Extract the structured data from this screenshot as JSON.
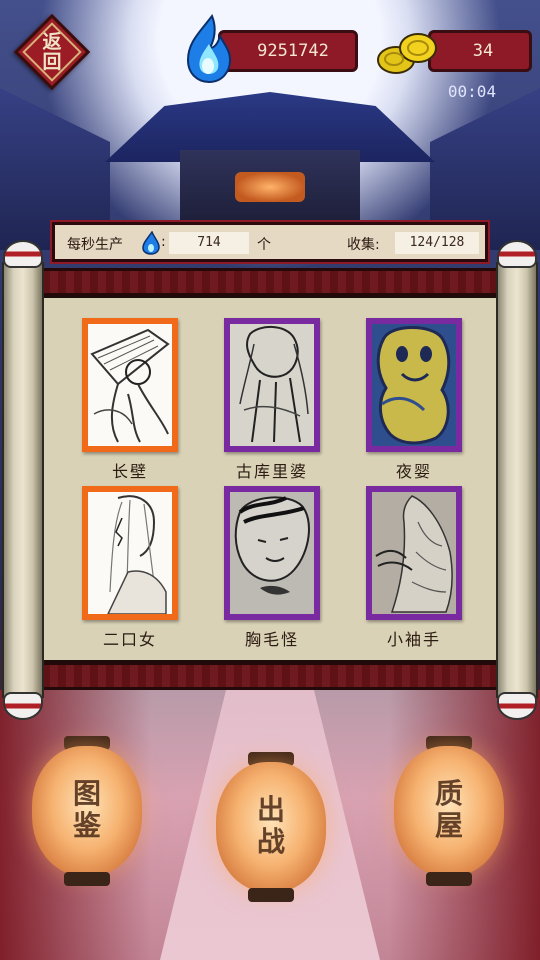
{
  "header": {
    "back_label_1": "返",
    "back_label_2": "回",
    "soul_fire": "9251742",
    "gold": "34",
    "timer": "00:04"
  },
  "info": {
    "production_label": "每秒生产",
    "production_value": "714",
    "production_unit": "个",
    "collect_label": "收集:",
    "collect_value": "124/128"
  },
  "monsters": [
    {
      "name": "长壁",
      "frame_color": "orange"
    },
    {
      "name": "古库里婆",
      "frame_color": "purple"
    },
    {
      "name": "夜婴",
      "frame_color": "purple"
    },
    {
      "name": "二口女",
      "frame_color": "orange"
    },
    {
      "name": "胸毛怪",
      "frame_color": "purple"
    },
    {
      "name": "小袖手",
      "frame_color": "purple"
    }
  ],
  "lanterns": {
    "left": "图鉴",
    "center": "出战",
    "right": "质屋"
  },
  "colors": {
    "frame_orange": "#f06a1a",
    "frame_purple": "#7a2aa0",
    "pill_red": "#8e1a28"
  }
}
